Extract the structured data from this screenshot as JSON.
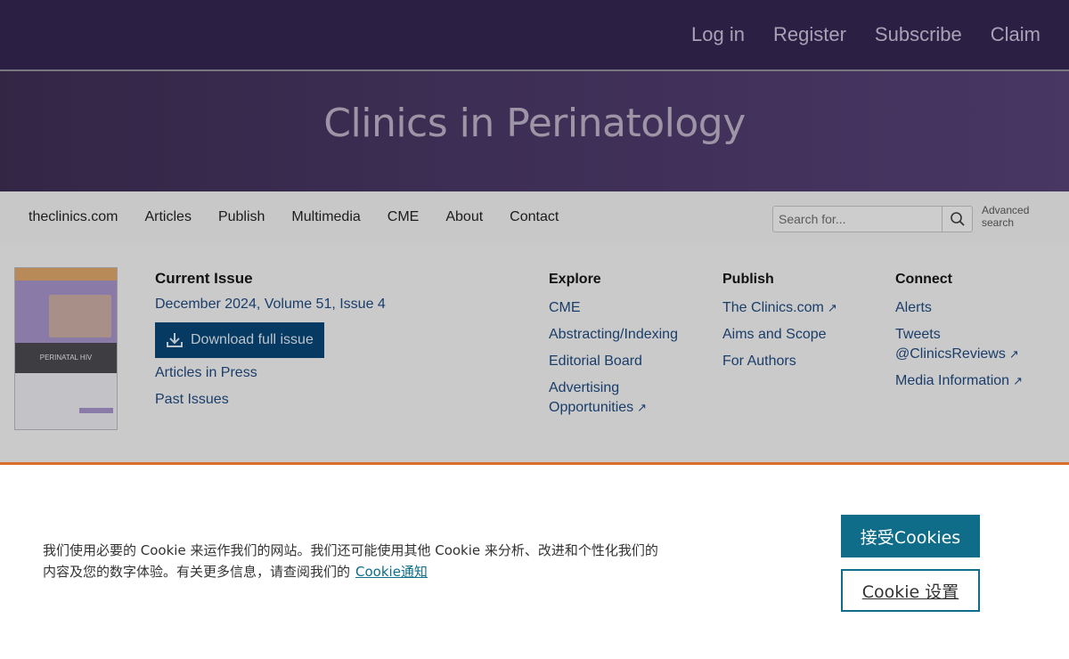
{
  "top_links": [
    "Log in",
    "Register",
    "Subscribe",
    "Claim"
  ],
  "journal_title": "Clinics in Perinatology",
  "nav_items": [
    "theclinics.com",
    "Articles",
    "Publish",
    "Multimedia",
    "CME",
    "About",
    "Contact"
  ],
  "search": {
    "placeholder": "Search for...",
    "icon": "search-icon",
    "advanced_label": "Advanced search"
  },
  "cover": {
    "topic": "PERINATAL HIV"
  },
  "current_issue": {
    "heading": "Current Issue",
    "issue_info": "December 2024, Volume 51, Issue 4",
    "download_label": "Download full issue",
    "articles_in_press": "Articles in Press",
    "past_issues": "Past Issues"
  },
  "explore": {
    "heading": "Explore",
    "items": [
      "CME",
      "Abstracting/Indexing",
      "Editorial Board",
      "Advertising Opportunities"
    ]
  },
  "publish": {
    "heading": "Publish",
    "items": [
      "The Clinics.com",
      "Aims and Scope",
      "For Authors"
    ]
  },
  "connect": {
    "heading": "Connect",
    "items": [
      "Alerts",
      "Tweets @ClinicsReviews",
      "Media Information"
    ]
  },
  "cookie_banner": {
    "text": "我们使用必要的 Cookie 来运作我们的网站。我们还可能使用其他 Cookie 来分析、改进和个性化我们的内容及您的数字体验。有关更多信息，请查阅我们的",
    "link_label": "Cookie通知",
    "accept_label": "接受Cookies",
    "settings_label": "Cookie 设置"
  },
  "colors": {
    "header_bg": "#2b1f44",
    "nav_bg": "#c8c8c8",
    "link": "#1a3d6a",
    "download_bg": "#063a62",
    "accent_rule": "#d8702a",
    "cookie_button": "#0f6d8a"
  }
}
